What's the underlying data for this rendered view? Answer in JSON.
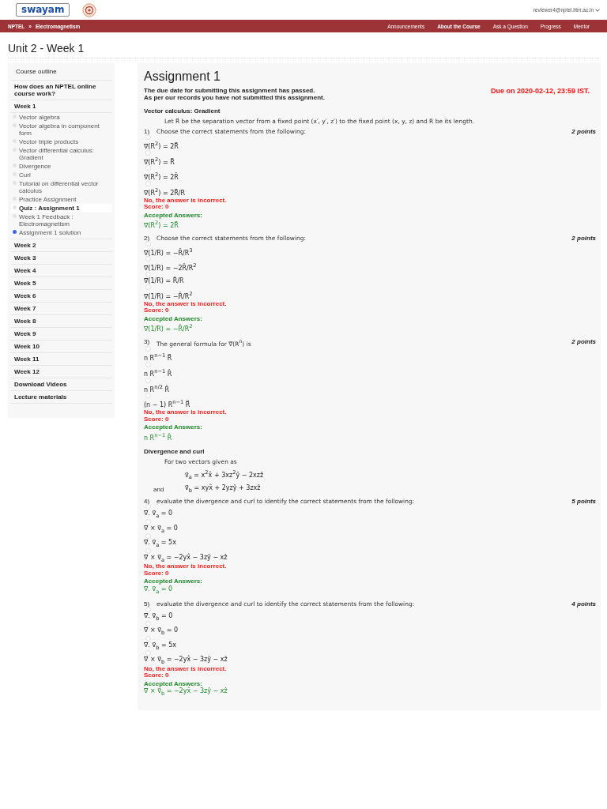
{
  "header": {
    "logo": "swayam",
    "user": "reviewer4@nptel.iitm.ac.in",
    "breadcrumb": [
      "NPTEL",
      "Electromagnetism"
    ],
    "breadcrumb_separator": "»",
    "nav": [
      "Announcements",
      "About the Course",
      "Ask a Question",
      "Progress",
      "Mentor"
    ]
  },
  "page_title": "Unit 2 - Week 1",
  "sidebar": {
    "title": "Course outline",
    "items": [
      {
        "label": "How does an NPTEL online course work?"
      },
      {
        "label": "Week 1",
        "children": [
          {
            "label": "Vector algebra",
            "selected": false,
            "color": "#e4e4e4"
          },
          {
            "label": "Vector algebra in component form",
            "selected": false,
            "color": "#e4e4e4"
          },
          {
            "label": "Vector triple products",
            "selected": false,
            "color": "#e4e4e4"
          },
          {
            "label": "Vector differential calculus: Gradient",
            "selected": false,
            "color": "#e4e4e4"
          },
          {
            "label": "Divergence",
            "selected": false,
            "color": "#e4e4e4"
          },
          {
            "label": "Curl",
            "selected": false,
            "color": "#e4e4e4"
          },
          {
            "label": "Tutorial on differential vector calculus",
            "selected": false,
            "color": "#e4e4e4"
          },
          {
            "label": "Practice Assignment",
            "selected": false,
            "color": "#e4e4e4"
          },
          {
            "label": "Quiz : Assignment 1",
            "selected": true,
            "color": "#e4e4e4"
          },
          {
            "label": "Week 1 Feedback : Electromagnetism",
            "selected": false,
            "color": "#e4e4e4"
          },
          {
            "label": "Assignment 1 solution",
            "selected": false,
            "color": "#3b63f2"
          }
        ]
      },
      {
        "label": "Week 2"
      },
      {
        "label": "Week 3"
      },
      {
        "label": "Week 4"
      },
      {
        "label": "Week 5"
      },
      {
        "label": "Week 6"
      },
      {
        "label": "Week 7"
      },
      {
        "label": "Week 8"
      },
      {
        "label": "Week 9"
      },
      {
        "label": "Week 10"
      },
      {
        "label": "Week 11"
      },
      {
        "label": "Week 12"
      },
      {
        "label": "Download Videos"
      },
      {
        "label": "Lecture materials"
      }
    ]
  },
  "assignment": {
    "title": "Assignment 1",
    "notices": [
      "The due date for submitting this assignment has passed.",
      "As per our records you have not submitted this assignment."
    ],
    "due": "Due on 2020-02-12, 23:59 IST.",
    "blocks": [
      {
        "kind": "heading",
        "text": "Vector calculus: Gradient"
      },
      {
        "kind": "text",
        "text": "Let R⃗ be the separation vector from a fixed point (x′, y′, z′) to the fixed point (x, y, z) and R be its length."
      },
      {
        "kind": "question",
        "number": "1)",
        "prompt": "Choose the correct statements from the following:",
        "points": "2 points",
        "options": [
          {
            "text": "∇⃗(R$^{2}$) = 2R⃗",
            "selected": false
          },
          {
            "text": "∇⃗(R$^{2}$) = R⃗",
            "selected": false
          },
          {
            "text": "∇⃗(R$^{2}$) = 2R̂",
            "selected": false
          },
          {
            "text": "∇⃗(R$^{2}$) = 2R⃗/R",
            "selected": false
          }
        ],
        "feedback": "No, the answer is incorrect.",
        "score": "Score: 0",
        "accepted_label": "Accepted Answers:",
        "accepted": [
          "∇⃗(R$^{2}$) = 2R⃗"
        ]
      },
      {
        "kind": "question",
        "number": "2)",
        "prompt": "Choose the correct statements from the following:",
        "points": "2 points",
        "options": [
          {
            "text": "∇⃗(1/R) = −R̂/R$^{3}$",
            "selected": false
          },
          {
            "text": "∇⃗(1/R) = −2R̂/R$^{2}$",
            "selected": false
          },
          {
            "text": "∇⃗(1/R) = R̂/R",
            "selected": false
          },
          {
            "text": "∇⃗(1/R) = −R̂/R$^{2}$",
            "selected": false
          }
        ],
        "feedback": "No, the answer is incorrect.",
        "score": "Score: 0",
        "accepted_label": "Accepted Answers:",
        "accepted": [
          "∇⃗(1/R) = −R̂/R$^{2}$"
        ]
      },
      {
        "kind": "question",
        "number": "3)",
        "prompt": "The general formula for ∇⃗(R$^{n}$) is",
        "points": "2 points",
        "options": [
          {
            "text": "n R$^{n−1}$ R⃗",
            "selected": false
          },
          {
            "text": "n R$^{n−1}$ R̂",
            "selected": false
          },
          {
            "text": "n R$^{n/2}$ R̂",
            "selected": false
          },
          {
            "text": "(n − 1) R$^{n−1}$ R⃗",
            "selected": false
          }
        ],
        "feedback": "No, the answer is incorrect.",
        "score": "Score: 0",
        "accepted_label": "Accepted Answers:",
        "accepted": [
          "n R$^{n−1}$ R̂"
        ]
      },
      {
        "kind": "heading",
        "text": "Divergence and curl"
      },
      {
        "kind": "text",
        "text": "For two vectors given as"
      },
      {
        "kind": "equation",
        "text": "v⃗$_{a}$ = x$^{2}$x̂ + 3xz$^{2}$ŷ − 2xzẑ"
      },
      {
        "kind": "equation",
        "label": "and",
        "text": "v⃗$_{b}$ = xyx̂ + 2yzŷ + 3zxẑ"
      },
      {
        "kind": "question",
        "number": "4)",
        "prompt": "evaluate the divergence and curl to identify the correct statements from the following:",
        "points": "5 points",
        "options": [
          {
            "text": "∇⃗. v⃗$_{a}$ = 0",
            "selected": false
          },
          {
            "text": "∇⃗ × v⃗$_{a}$ = 0",
            "selected": false
          },
          {
            "text": "∇⃗. v⃗$_{a}$ = 5x",
            "selected": false
          },
          {
            "text": "∇⃗ × v⃗$_{a}$ = −2yx̂ − 3zŷ − xẑ",
            "selected": false
          }
        ],
        "feedback": "No, the answer is incorrect.",
        "score": "Score: 0",
        "accepted_label": "Accepted Answers:",
        "accepted": [
          "∇⃗. v⃗$_{a}$ = 0"
        ]
      },
      {
        "kind": "question",
        "number": "5)",
        "prompt": "evaluate the divergence and curl to identify the correct statements from the following:",
        "points": "4 points",
        "options": [
          {
            "text": "∇⃗. v⃗$_{b}$ = 0",
            "selected": false
          },
          {
            "text": "∇⃗ × v⃗$_{b}$ = 0",
            "selected": false
          },
          {
            "text": "∇⃗. v⃗$_{b}$ = 5x",
            "selected": false
          },
          {
            "text": "∇⃗ × v⃗$_{b}$ = −2yx̂ − 3zŷ − xẑ",
            "selected": false
          }
        ],
        "feedback": "No, the answer is incorrect.",
        "score": "Score: 0",
        "accepted_label": "Accepted Answers:",
        "accepted": [
          "∇⃗ × v⃗$_{b}$ = −2yx̂ − 3zŷ − xẑ"
        ]
      }
    ]
  }
}
